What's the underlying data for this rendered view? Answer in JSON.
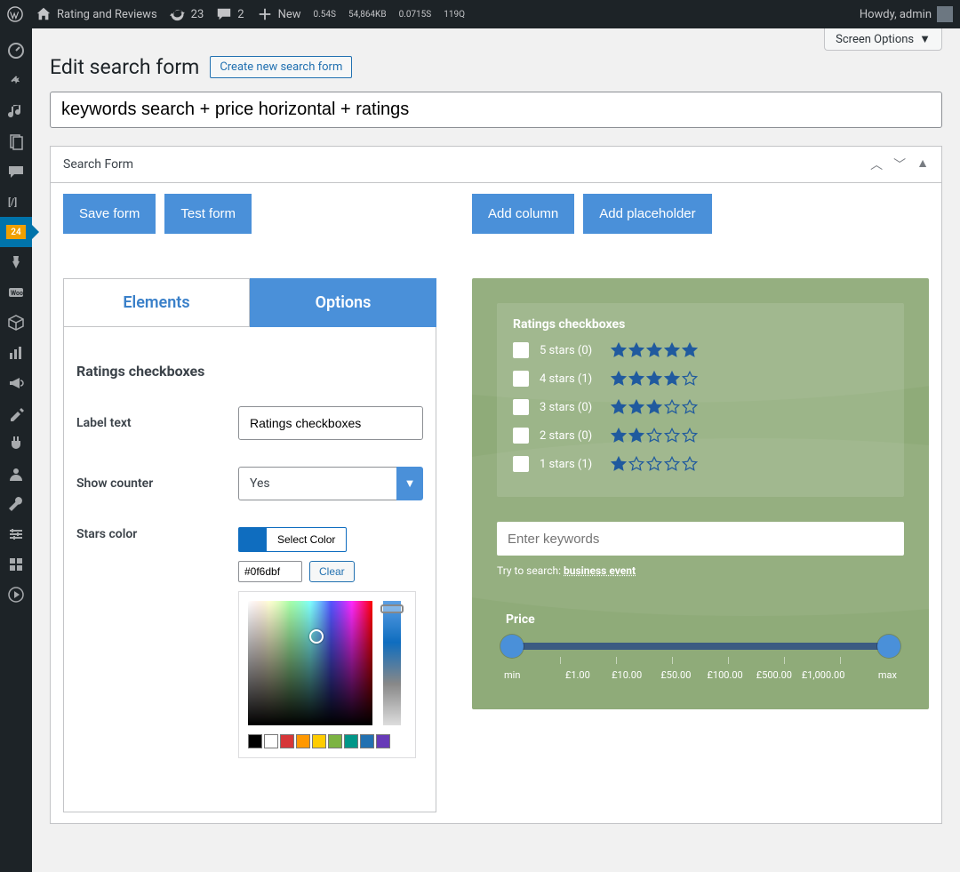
{
  "adminbar": {
    "site": "Rating and Reviews",
    "updates": "23",
    "comments": "2",
    "new": "New",
    "stats": [
      "0.54S",
      "54,864KB",
      "0.0715S",
      "119Q"
    ],
    "howdy": "Howdy, admin"
  },
  "sidebar": {
    "badge": "24"
  },
  "screenOptions": "Screen Options",
  "page": {
    "title": "Edit search form",
    "create": "Create new search form",
    "formName": "keywords search + price horizontal + ratings"
  },
  "panel": {
    "title": "Search Form",
    "saveBtn": "Save form",
    "testBtn": "Test form",
    "addColumn": "Add column",
    "addPlaceholder": "Add placeholder"
  },
  "tabs": {
    "elements": "Elements",
    "options": "Options"
  },
  "options": {
    "section": "Ratings checkboxes",
    "labelText": {
      "label": "Label text",
      "value": "Ratings checkboxes"
    },
    "showCounter": {
      "label": "Show counter",
      "value": "Yes"
    },
    "starsColor": {
      "label": "Stars color",
      "button": "Select Color",
      "hex": "#0f6dbf",
      "clear": "Clear"
    },
    "palette": [
      "#000000",
      "#ffffff",
      "#d63638",
      "#ff9800",
      "#ffcc00",
      "#7cb342",
      "#009688",
      "#2271b1",
      "#673ab7"
    ]
  },
  "preview": {
    "ratingsTitle": "Ratings checkboxes",
    "ratings": [
      {
        "label": "5 stars (0)",
        "filled": 5
      },
      {
        "label": "4 stars (1)",
        "filled": 4
      },
      {
        "label": "3 stars (0)",
        "filled": 3
      },
      {
        "label": "2 stars (0)",
        "filled": 2
      },
      {
        "label": "1 stars (1)",
        "filled": 1
      }
    ],
    "searchPlaceholder": "Enter keywords",
    "tryLabel": "Try to search:",
    "tryLinks": "business event",
    "priceTitle": "Price",
    "priceTicks": [
      "min",
      "£1.00",
      "£10.00",
      "£50.00",
      "£100.00",
      "£500.00",
      "£1,000.00",
      "max"
    ]
  },
  "starColor": "#205a9e"
}
